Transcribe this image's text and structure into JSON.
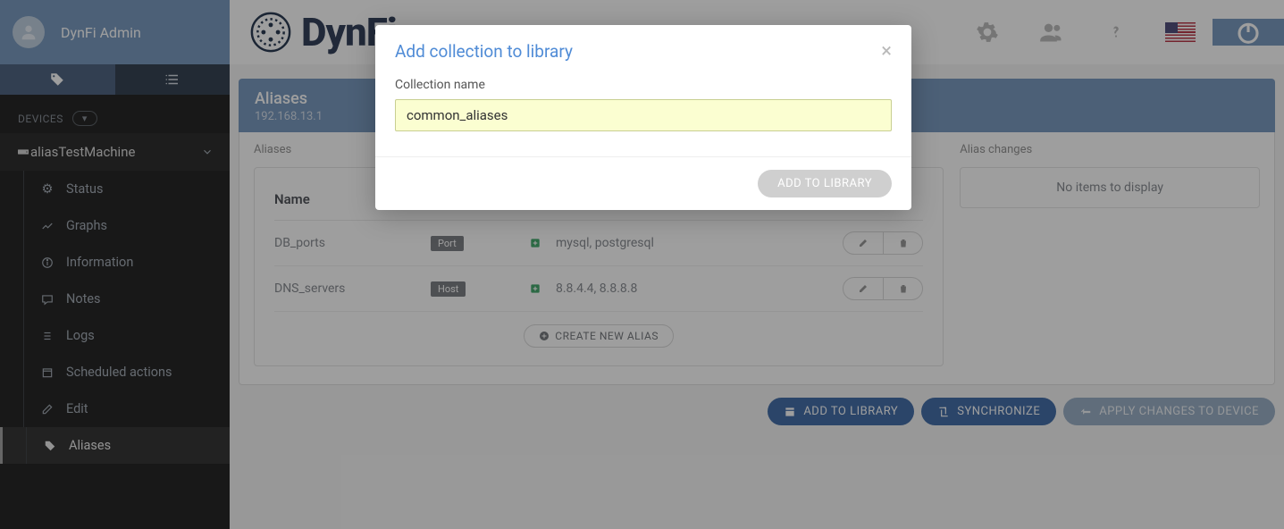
{
  "header": {
    "user_name": "DynFi Admin",
    "logo_text": "DynFi"
  },
  "sidebar": {
    "section_label": "DEVICES",
    "device_name": "aliasTestMachine",
    "items": [
      {
        "label": "Status"
      },
      {
        "label": "Graphs"
      },
      {
        "label": "Information"
      },
      {
        "label": "Notes"
      },
      {
        "label": "Logs"
      },
      {
        "label": "Scheduled actions"
      },
      {
        "label": "Edit"
      },
      {
        "label": "Aliases"
      }
    ]
  },
  "panel": {
    "title": "Aliases",
    "subtitle": "192.168.13.1",
    "aliases_label": "Aliases",
    "changes_label": "Alias changes",
    "no_items": "No items to display",
    "name_col": "Name",
    "rows": [
      {
        "name": "DB_ports",
        "type": "Port",
        "values": "mysql, postgresql"
      },
      {
        "name": "DNS_servers",
        "type": "Host",
        "values": "8.8.4.4, 8.8.8.8"
      }
    ],
    "create_label": "CREATE NEW ALIAS",
    "btn_add": "ADD TO LIBRARY",
    "btn_sync": "SYNCHRONIZE",
    "btn_apply": "APPLY CHANGES TO DEVICE"
  },
  "modal": {
    "title": "Add collection to library",
    "field_label": "Collection name",
    "value": "common_aliases",
    "submit": "ADD TO LIBRARY"
  }
}
